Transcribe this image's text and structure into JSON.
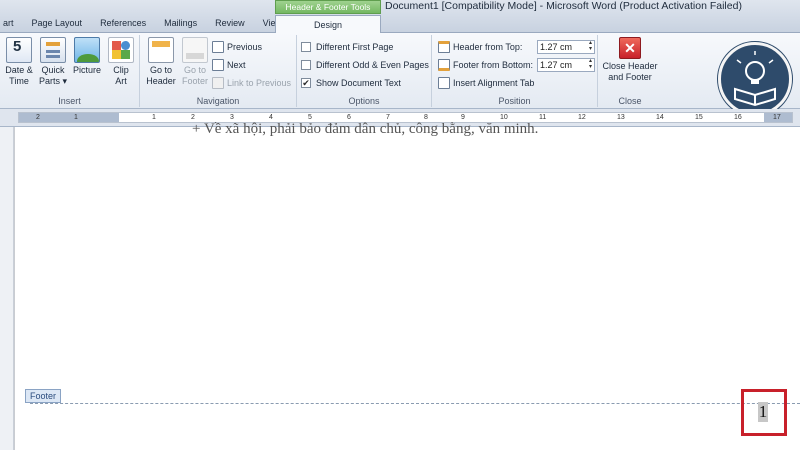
{
  "titlebar": {
    "tabs": [
      "art",
      "Page Layout",
      "References",
      "Mailings",
      "Review",
      "View"
    ],
    "context_header": "Header & Footer Tools",
    "active_tab": "Design",
    "window_title": "Document1 [Compatibility Mode] - Microsoft Word (Product Activation Failed)"
  },
  "ribbon": {
    "insert": {
      "label": "Insert",
      "date_time": "Date &\nTime",
      "quick_parts": "Quick\nParts ▾",
      "picture": "Picture",
      "clip_art": "Clip\nArt"
    },
    "navigation": {
      "label": "Navigation",
      "go_to_header": "Go to\nHeader",
      "go_to_footer": "Go to\nFooter",
      "previous": "Previous",
      "next": "Next",
      "link_to_previous": "Link to Previous"
    },
    "options": {
      "label": "Options",
      "different_first_page": "Different First Page",
      "different_odd_even": "Different Odd & Even Pages",
      "show_document_text": "Show Document Text",
      "show_document_text_checked": true
    },
    "position": {
      "label": "Position",
      "header_from_top": "Header from Top:",
      "header_from_top_value": "1.27 cm",
      "footer_from_bottom": "Footer from Bottom:",
      "footer_from_bottom_value": "1.27 cm",
      "insert_alignment_tab": "Insert Alignment Tab"
    },
    "close": {
      "label": "Close",
      "close_header_footer": "Close Header\nand Footer"
    }
  },
  "ruler": {
    "ticks": [
      "2",
      "1",
      "1",
      "2",
      "3",
      "4",
      "5",
      "6",
      "7",
      "8",
      "9",
      "10",
      "11",
      "12",
      "13",
      "14",
      "15",
      "16",
      "17"
    ]
  },
  "document": {
    "body_line": "+    Về xã hội, phải bảo đảm dân chủ, công bằng, văn minh.",
    "footer_tag": "Footer",
    "page_number": "1"
  },
  "colors": {
    "accent_red": "#c8202a",
    "context_green": "#74b862",
    "logo_navy": "#2e4b6b"
  }
}
